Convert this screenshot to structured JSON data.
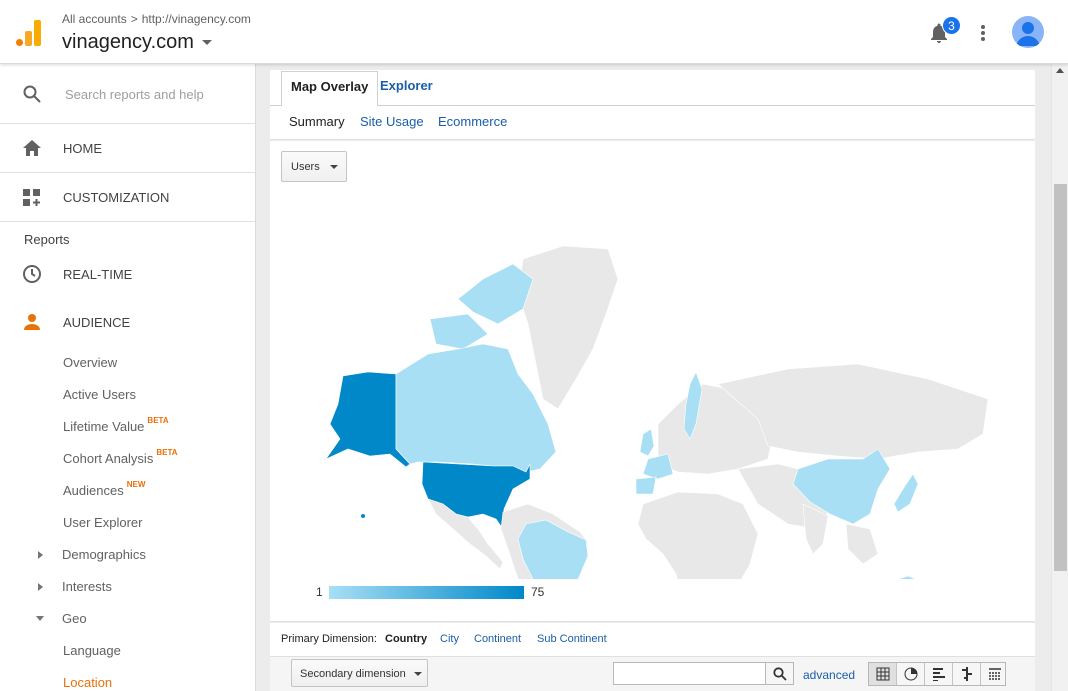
{
  "header": {
    "breadcrumb_root": "All accounts",
    "breadcrumb_sep": ">",
    "breadcrumb_site": "http://vinagency.com",
    "account_name": "vinagency.com",
    "notification_count": "3"
  },
  "sidebar": {
    "search_placeholder": "Search reports and help",
    "home": "HOME",
    "customization": "CUSTOMIZATION",
    "reports_label": "Reports",
    "realtime": "REAL-TIME",
    "audience": "AUDIENCE",
    "audience_items": {
      "overview": "Overview",
      "active_users": "Active Users",
      "lifetime_value": "Lifetime Value",
      "lifetime_badge": "BETA",
      "cohort": "Cohort Analysis",
      "cohort_badge": "BETA",
      "audiences": "Audiences",
      "audiences_badge": "NEW",
      "user_explorer": "User Explorer",
      "demographics": "Demographics",
      "interests": "Interests",
      "geo": "Geo",
      "language": "Language",
      "location": "Location"
    }
  },
  "main": {
    "tabs": [
      "Map Overlay",
      "Explorer"
    ],
    "subtabs": [
      "Summary",
      "Site Usage",
      "Ecommerce"
    ],
    "metric_dropdown": "Users",
    "legend_min": "1",
    "legend_max": "75",
    "primary_dimension_label": "Primary Dimension:",
    "dimensions": [
      "Country",
      "City",
      "Continent",
      "Sub Continent"
    ],
    "secondary_dimension": "Secondary dimension",
    "search_value": "",
    "advanced": "advanced"
  },
  "colors": {
    "accent": "#e8710a",
    "link": "#1a5ea8",
    "map_high": "#0088c9",
    "map_low": "#a8dff5",
    "map_none": "#e8e8e8"
  }
}
